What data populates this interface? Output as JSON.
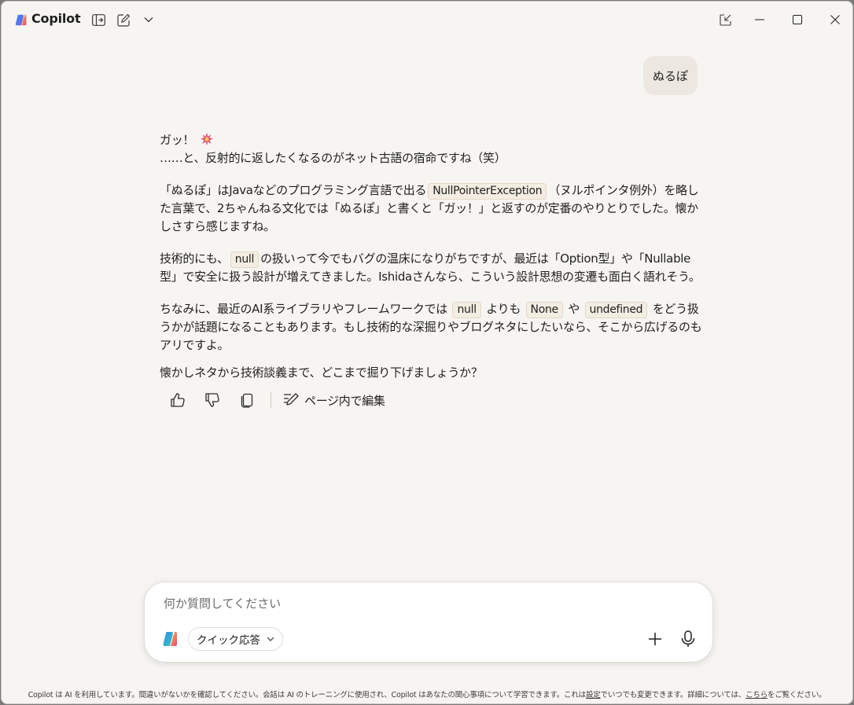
{
  "titlebar": {
    "app_title": "Copilot",
    "icons": [
      "copilot-logo",
      "sidebar-toggle-icon",
      "new-chat-icon",
      "chevron-down-icon"
    ],
    "window_controls": [
      "popout-icon",
      "minimize-icon",
      "maximize-icon",
      "close-icon"
    ]
  },
  "conversation": {
    "user_message": "ぬるぽ",
    "answer": {
      "p1_line1": "ガッ！",
      "p1_line2": "……と、反射的に返したくなるのがネット古語の宿命ですね（笑）",
      "p2_before": "「ぬるぽ」はJavaなどのプログラミング言語で出る",
      "p2_code": "NullPointerException",
      "p2_after": "（ヌルポインタ例外）を略した言葉で、2ちゃんねる文化では「ぬるぽ」と書くと「ガッ！」と返すのが定番のやりとりでした。懐かしさすら感じますね。",
      "p3_before": "技術的にも、",
      "p3_code": "null",
      "p3_after": "の扱いって今でもバグの温床になりがちですが、最近は「Option型」や「Nullable型」で安全に扱う設計が増えてきました。Ishidaさんなら、こういう設計思想の変遷も面白く語れそう。",
      "p4_a": "ちなみに、最近のAI系ライブラリやフレームワークでは",
      "p4_code1": "null",
      "p4_b": "よりも",
      "p4_code2": "None",
      "p4_c": "や",
      "p4_code3": "undefined",
      "p4_d": "をどう扱うかが話題になることもあります。もし技術的な深掘りやブログネタにしたいなら、そこから広げるのもアリですよ。",
      "p5": "懐かしネタから技術談義まで、どこまで掘り下げましょうか？"
    },
    "actions": {
      "edit_label": "ページ内で編集"
    }
  },
  "composer": {
    "placeholder": "何か質問してください",
    "quick_label": "クイック応答"
  },
  "footer": {
    "text_a": "Copilot は AI を利用しています。間違いがないかを確認してください。会話は AI のトレーニングに使用され、Copilot はあなたの関心事項について学習できます。これは",
    "link1": "設定",
    "text_b": "でいつでも変更できます。詳細については、",
    "link2": "こちら",
    "text_c": "をご覧ください。"
  },
  "colors": {
    "window_bg": "#f7f5f1",
    "bubble_bg": "#ece8e1",
    "code_bg": "#f3ede2",
    "spark_accent": "#e0457b"
  }
}
